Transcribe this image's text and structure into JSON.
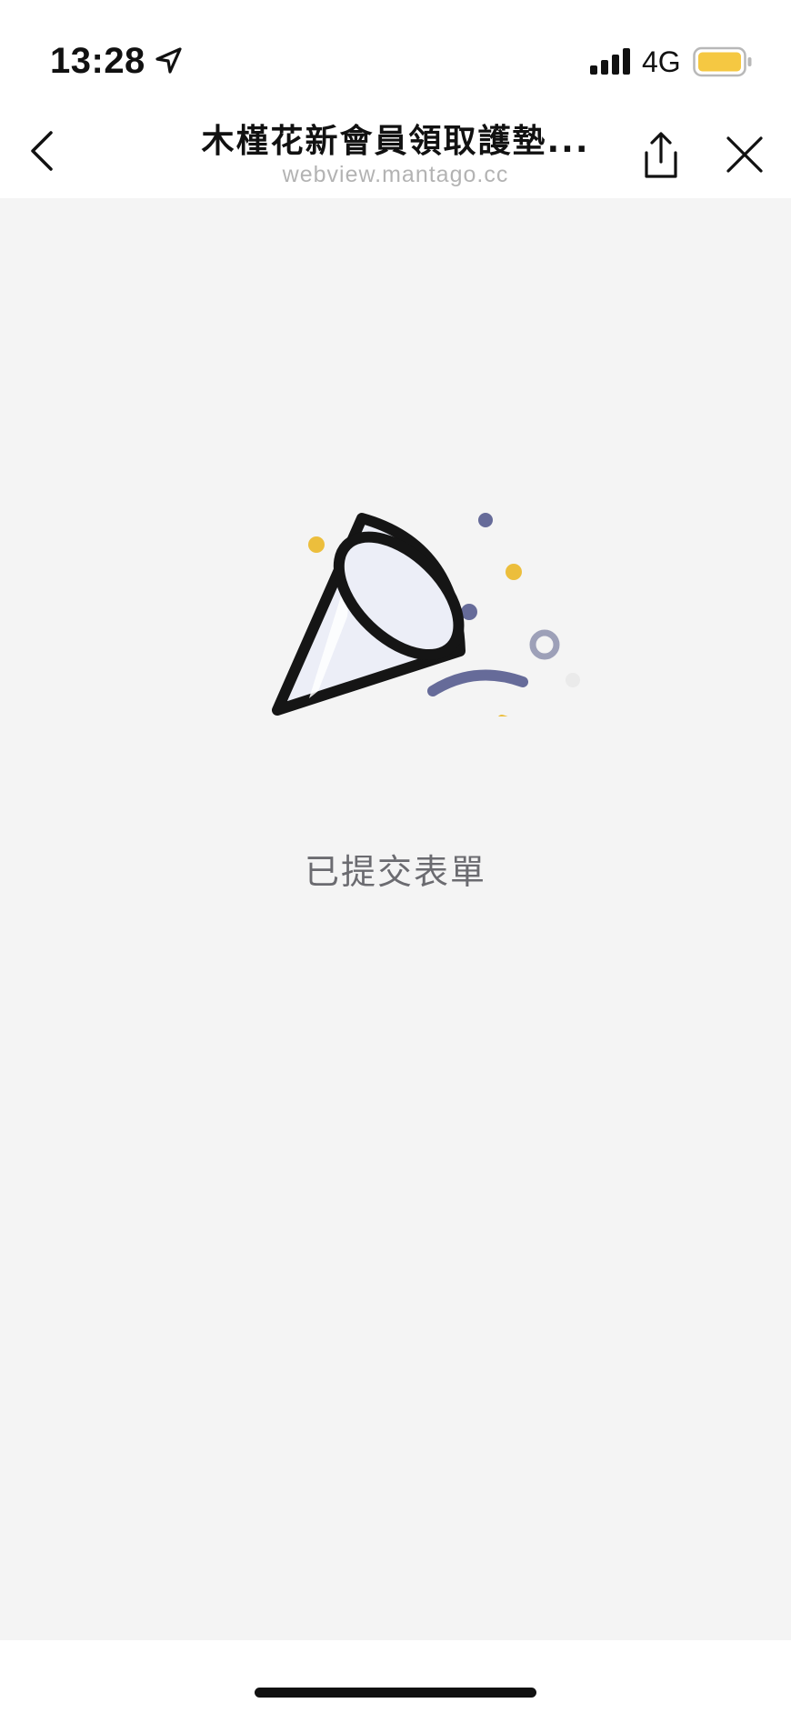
{
  "status_bar": {
    "time": "13:28",
    "network": "4G",
    "battery_color": "#f5c842"
  },
  "nav": {
    "title": "木槿花新會員領取護墊...",
    "domain": "webview.mantago.cc"
  },
  "content": {
    "message": "已提交表單",
    "background_color": "#f4f4f4",
    "accent_colors": {
      "purple": "#666b99",
      "yellow": "#ecbe3c"
    }
  }
}
